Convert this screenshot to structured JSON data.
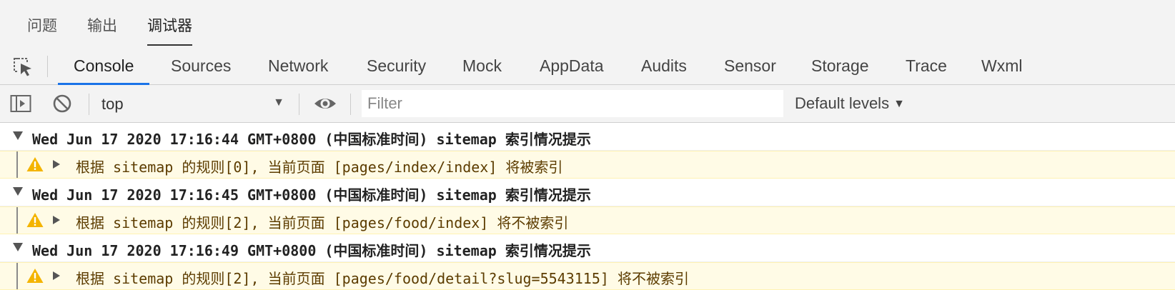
{
  "panel_tabs": [
    {
      "label": "问题",
      "active": false
    },
    {
      "label": "输出",
      "active": false
    },
    {
      "label": "调试器",
      "active": true
    }
  ],
  "devtools_tabs": [
    {
      "label": "Console",
      "active": true
    },
    {
      "label": "Sources"
    },
    {
      "label": "Network"
    },
    {
      "label": "Security"
    },
    {
      "label": "Mock"
    },
    {
      "label": "AppData"
    },
    {
      "label": "Audits"
    },
    {
      "label": "Sensor"
    },
    {
      "label": "Storage"
    },
    {
      "label": "Trace"
    },
    {
      "label": "Wxml"
    }
  ],
  "toolbar": {
    "context": "top",
    "filter_placeholder": "Filter",
    "levels_label": "Default levels"
  },
  "console": {
    "groups": [
      {
        "header": "Wed Jun 17 2020 17:16:44 GMT+0800 (中国标准时间) sitemap 索引情况提示",
        "message": "根据 sitemap 的规则[0], 当前页面 [pages/index/index] 将被索引"
      },
      {
        "header": "Wed Jun 17 2020 17:16:45 GMT+0800 (中国标准时间) sitemap 索引情况提示",
        "message": "根据 sitemap 的规则[2], 当前页面 [pages/food/index] 将不被索引"
      },
      {
        "header": "Wed Jun 17 2020 17:16:49 GMT+0800 (中国标准时间) sitemap 索引情况提示",
        "message": "根据 sitemap 的规则[2], 当前页面 [pages/food/detail?slug=5543115] 将不被索引"
      }
    ]
  },
  "colors": {
    "active_tab_underline": "#1a73e8",
    "warning_background": "#fffbe6",
    "warning_icon": "#f4b400"
  }
}
